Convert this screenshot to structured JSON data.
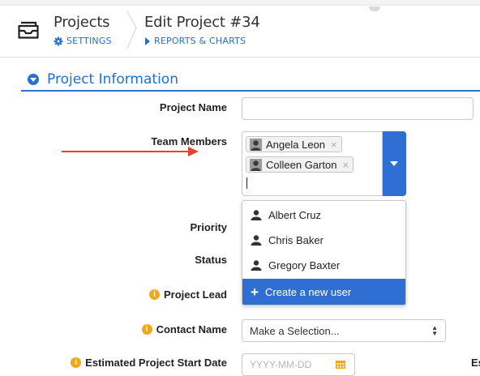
{
  "header": {
    "app_title": "Projects",
    "app_sub": "SETTINGS",
    "page_title": "Edit Project #34",
    "page_sub": "REPORTS & CHARTS"
  },
  "section": {
    "title": "Project Information"
  },
  "form": {
    "project_name_label": "Project Name",
    "project_name_value": "",
    "team_members_label": "Team Members",
    "team_members": [
      "Angela Leon",
      "Colleen Garton"
    ],
    "chip_remove": "×",
    "priority_label": "Priority",
    "status_label": "Status",
    "project_lead_label": "Project Lead",
    "contact_name_label": "Contact Name",
    "contact_name_value": "Make a Selection...",
    "start_date_label": "Estimated Project Start Date",
    "start_date_placeholder": "YYYY-MM-DD",
    "truncated_right_label": "Es",
    "info_glyph": "i"
  },
  "dropdown": {
    "options": [
      "Albert Cruz",
      "Chris Baker",
      "Gregory Baxter"
    ],
    "create_label": "Create a new user",
    "create_icon": "+"
  },
  "colors": {
    "accent": "#2f6fd3",
    "arrow": "#e8432a",
    "info": "#f0a818"
  },
  "icons": [
    "folder-tray-icon",
    "gear-icon",
    "play-icon",
    "user-icon",
    "plus-icon",
    "info-icon",
    "calendar-icon",
    "select-arrows-icon"
  ]
}
